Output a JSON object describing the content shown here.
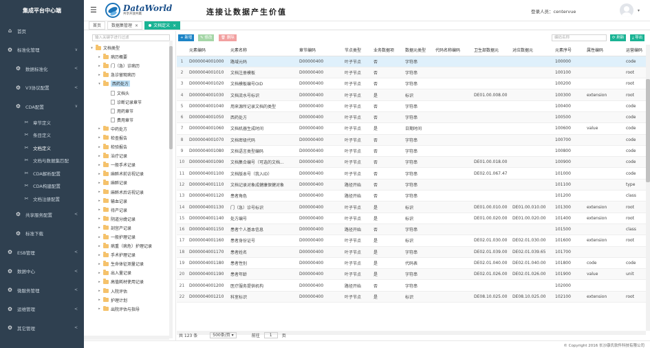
{
  "app": {
    "title": "集成平台中心端"
  },
  "sidebar": {
    "items": [
      {
        "label": "首页",
        "icon": "home-icon",
        "level": 1,
        "arrow": ""
      },
      {
        "label": "标准化管理",
        "icon": "gear-icon",
        "level": 1,
        "arrow": "∨"
      },
      {
        "label": "数据标准化",
        "icon": "gear-icon",
        "level": 2,
        "arrow": "<"
      },
      {
        "label": "V3协议配置",
        "icon": "gear-icon",
        "level": 2,
        "arrow": "<"
      },
      {
        "label": "CDA配置",
        "icon": "gear-icon",
        "level": 2,
        "arrow": "∨"
      },
      {
        "label": "章节定义",
        "icon": "cut-icon",
        "level": 3,
        "arrow": ""
      },
      {
        "label": "条目定义",
        "icon": "cut-icon",
        "level": 3,
        "arrow": ""
      },
      {
        "label": "文档定义",
        "icon": "cut-icon",
        "level": 3,
        "arrow": "",
        "active": true
      },
      {
        "label": "文档与数据集匹配",
        "icon": "cut-icon",
        "level": 3,
        "arrow": ""
      },
      {
        "label": "CDA解析配置",
        "icon": "cut-icon",
        "level": 3,
        "arrow": ""
      },
      {
        "label": "CDA构建配置",
        "icon": "cut-icon",
        "level": 3,
        "arrow": ""
      },
      {
        "label": "文档注册配置",
        "icon": "cut-icon",
        "level": 3,
        "arrow": ""
      },
      {
        "label": "共享服务配置",
        "icon": "gear-icon",
        "level": 2,
        "arrow": "<"
      },
      {
        "label": "标准下载",
        "icon": "gear-icon",
        "level": 2,
        "arrow": ""
      },
      {
        "label": "ESB管理",
        "icon": "gear-icon",
        "level": 1,
        "arrow": "<"
      },
      {
        "label": "数据中心",
        "icon": "gear-icon",
        "level": 1,
        "arrow": "<"
      },
      {
        "label": "微服务管理",
        "icon": "gear-icon",
        "level": 1,
        "arrow": "<"
      },
      {
        "label": "运维管理",
        "icon": "gear-icon",
        "level": 1,
        "arrow": "<"
      },
      {
        "label": "其它管理",
        "icon": "gear-icon",
        "level": 1,
        "arrow": "<"
      }
    ]
  },
  "header": {
    "logo_title": "DataWorld",
    "logo_sub": "共享开放共赢",
    "slogan": "连接让数据产生价值",
    "user_label": "登录人员：centervue"
  },
  "tabs": [
    {
      "label": "首页",
      "active": false
    },
    {
      "label": "数据集管理",
      "active": false,
      "close": "×"
    },
    {
      "label": "文档定义",
      "active": true,
      "close": "×"
    }
  ],
  "tree": {
    "search_placeholder": "输入关键字进行过滤",
    "nodes": [
      {
        "label": "文档类型",
        "depth": 0,
        "toggle": "▾",
        "type": "folder"
      },
      {
        "label": "病历概要",
        "depth": 1,
        "toggle": "▸",
        "type": "folder"
      },
      {
        "label": "门（急）诊病历",
        "depth": 1,
        "toggle": "▸",
        "type": "folder"
      },
      {
        "label": "急诊留观病历",
        "depth": 1,
        "toggle": "▸",
        "type": "folder"
      },
      {
        "label": "西药处方",
        "depth": 1,
        "toggle": "▾",
        "type": "folder",
        "selected": true
      },
      {
        "label": "文档头",
        "depth": 2,
        "toggle": "",
        "type": "file"
      },
      {
        "label": "诊断记录章节",
        "depth": 2,
        "toggle": "",
        "type": "file"
      },
      {
        "label": "用药章节",
        "depth": 2,
        "toggle": "",
        "type": "file"
      },
      {
        "label": "费用章节",
        "depth": 2,
        "toggle": "",
        "type": "file"
      },
      {
        "label": "中药处方",
        "depth": 1,
        "toggle": "▸",
        "type": "folder"
      },
      {
        "label": "检查报告",
        "depth": 1,
        "toggle": "▸",
        "type": "folder"
      },
      {
        "label": "检验报告",
        "depth": 1,
        "toggle": "▸",
        "type": "folder"
      },
      {
        "label": "治疗记录",
        "depth": 1,
        "toggle": "▸",
        "type": "folder"
      },
      {
        "label": "一般手术记录",
        "depth": 1,
        "toggle": "▸",
        "type": "folder"
      },
      {
        "label": "麻醉术前访视记录",
        "depth": 1,
        "toggle": "▸",
        "type": "folder"
      },
      {
        "label": "麻醉记录",
        "depth": 1,
        "toggle": "▸",
        "type": "folder"
      },
      {
        "label": "麻醉术后访视记录",
        "depth": 1,
        "toggle": "▸",
        "type": "folder"
      },
      {
        "label": "输血记录",
        "depth": 1,
        "toggle": "▸",
        "type": "folder"
      },
      {
        "label": "待产记录",
        "depth": 1,
        "toggle": "▸",
        "type": "folder"
      },
      {
        "label": "阴道分娩记录",
        "depth": 1,
        "toggle": "▸",
        "type": "folder"
      },
      {
        "label": "剖宫产记录",
        "depth": 1,
        "toggle": "▸",
        "type": "folder"
      },
      {
        "label": "一般护理记录",
        "depth": 1,
        "toggle": "▸",
        "type": "folder"
      },
      {
        "label": "病重（病危）护理记录",
        "depth": 1,
        "toggle": "▸",
        "type": "folder"
      },
      {
        "label": "手术护理记录",
        "depth": 1,
        "toggle": "▸",
        "type": "folder"
      },
      {
        "label": "生命体征测量记录",
        "depth": 1,
        "toggle": "▸",
        "type": "folder"
      },
      {
        "label": "出入量记录",
        "depth": 1,
        "toggle": "▸",
        "type": "folder"
      },
      {
        "label": "高值耗材使用记录",
        "depth": 1,
        "toggle": "▸",
        "type": "folder"
      },
      {
        "label": "入院评估",
        "depth": 1,
        "toggle": "▸",
        "type": "folder"
      },
      {
        "label": "护理计划",
        "depth": 1,
        "toggle": "▸",
        "type": "folder"
      },
      {
        "label": "出院评估与指导",
        "depth": 1,
        "toggle": "▸",
        "type": "folder"
      }
    ]
  },
  "toolbar": {
    "add_label": "+ 新增",
    "edit_label": "✎ 修改",
    "delete_label": "🗑 删除",
    "search_placeholder": "编码名称",
    "refresh_label": "⟳ 刷新",
    "export_label": "⤓ 导出"
  },
  "table": {
    "columns": [
      "",
      "元素编码",
      "元素名称",
      "章节编码",
      "节点类型",
      "业务数据项",
      "数据元类型",
      "代码名称编码",
      "卫生部数据元",
      "对应数据元",
      "元素序号",
      "属性编码",
      "运营编码"
    ],
    "rows": [
      [
        "1",
        "D000004001000",
        "路域元码",
        "D00000400",
        "叶子节点",
        "否",
        "字符串",
        "",
        "",
        "",
        "100000",
        "",
        "code"
      ],
      [
        "2",
        "D000004001010",
        "文档注册模板",
        "D00000400",
        "叶子节点",
        "否",
        "字符串",
        "",
        "",
        "",
        "100100",
        "",
        "root"
      ],
      [
        "3",
        "D000004001020",
        "文档模板编号OID",
        "D00000400",
        "叶子节点",
        "否",
        "字符串",
        "",
        "",
        "",
        "100200",
        "",
        "root"
      ],
      [
        "4",
        "D000004001030",
        "文档流水号标识",
        "D00000400",
        "叶子节点",
        "是",
        "标识",
        "",
        "DE01.00.008.00",
        "",
        "100300",
        "extension",
        "root"
      ],
      [
        "5",
        "D000004001040",
        "用来源所记录文档的类型",
        "D00000400",
        "叶子节点",
        "否",
        "字符串",
        "",
        "",
        "",
        "100400",
        "",
        "code"
      ],
      [
        "6",
        "D000004001050",
        "西药处方",
        "D00000400",
        "叶子节点",
        "否",
        "字符串",
        "",
        "",
        "",
        "100500",
        "",
        "code"
      ],
      [
        "7",
        "D000004001060",
        "文档机器生成时间",
        "D00000400",
        "叶子节点",
        "是",
        "日期时间",
        "",
        "",
        "",
        "100600",
        "value",
        "code"
      ],
      [
        "8",
        "D000004001070",
        "文档密级代码",
        "D00000400",
        "叶子节点",
        "否",
        "字符串",
        "",
        "",
        "",
        "100700",
        "",
        "code"
      ],
      [
        "9",
        "D000004001080",
        "文档语言类型编码",
        "D00000400",
        "叶子节点",
        "否",
        "字符串",
        "",
        "",
        "",
        "100800",
        "",
        "code"
      ],
      [
        "10",
        "D000004001090",
        "文档集合编号（可选的文档...",
        "D00000400",
        "叶子节点",
        "否",
        "字符串",
        "",
        "DE01.00.018.00",
        "",
        "100900",
        "",
        "code"
      ],
      [
        "11",
        "D000004001100",
        "文档版本号（我入ID）",
        "D00000400",
        "叶子节点",
        "否",
        "字符串",
        "",
        "DE02.01.067.47",
        "",
        "101000",
        "",
        "code"
      ],
      [
        "12",
        "D000004001110",
        "文档记录对象成健康保健对象",
        "D00000400",
        "路径开始",
        "否",
        "字符串",
        "",
        "",
        "",
        "101100",
        "",
        "type"
      ],
      [
        "13",
        "D000004001120",
        "患者角色",
        "D00000400",
        "路径开始",
        "否",
        "字符串",
        "",
        "",
        "",
        "101200",
        "",
        "class"
      ],
      [
        "14",
        "D000004001130",
        "门（急）诊号标识",
        "D00000400",
        "叶子节点",
        "是",
        "标识",
        "",
        "DE01.00.010.00",
        "DE01.00.010.00",
        "101300",
        "extension",
        "root"
      ],
      [
        "15",
        "D000004001140",
        "处方编号",
        "D00000400",
        "叶子节点",
        "是",
        "标识",
        "",
        "DE01.00.020.00",
        "DE01.00.020.00",
        "101400",
        "extension",
        "root"
      ],
      [
        "16",
        "D000004001150",
        "患者个人基本信息",
        "D00000400",
        "路径开始",
        "否",
        "字符串",
        "",
        "",
        "",
        "101500",
        "",
        "class"
      ],
      [
        "17",
        "D000004001160",
        "患者身份证号",
        "D00000400",
        "叶子节点",
        "是",
        "标识",
        "",
        "DE02.01.030.00",
        "DE02.01.030.00",
        "101600",
        "extension",
        "root"
      ],
      [
        "18",
        "D000004001170",
        "患者姓名",
        "D00000400",
        "叶子节点",
        "是",
        "字符串",
        "",
        "DE02.01.039.00",
        "DE02.01.039.65",
        "101700",
        "",
        ""
      ],
      [
        "19",
        "D000004001180",
        "患者性别",
        "D00000400",
        "叶子节点",
        "是",
        "代码表",
        "",
        "DE02.01.040.00",
        "DE02.01.040.00",
        "101800",
        "code",
        "code"
      ],
      [
        "20",
        "D000004001190",
        "患者年龄",
        "D00000400",
        "叶子节点",
        "是",
        "字符串",
        "",
        "DE02.01.026.00",
        "DE02.01.026.00",
        "101900",
        "value",
        "unit"
      ],
      [
        "21",
        "D000004001200",
        "医疗服务提供机构",
        "D00000400",
        "路径开始",
        "否",
        "字符串",
        "",
        "",
        "",
        "102000",
        "",
        ""
      ],
      [
        "22",
        "D000004001210",
        "科室标识",
        "D00000400",
        "叶子节点",
        "是",
        "标识",
        "",
        "DE08.10.025.00",
        "DE08.10.025.00",
        "102100",
        "extension",
        "root"
      ]
    ]
  },
  "pager": {
    "total": "共 123 条",
    "page_size": "500条/页 ▾",
    "prev": "前往",
    "page": "1",
    "page_suffix": "页"
  },
  "footer": {
    "copyright": "© Copyright 2016 长沙康氏软件科技有限公司"
  },
  "colors": {
    "sidebar_bg": "#2f4050",
    "accent": "#1ab394",
    "primary": "#1c84c6",
    "row_highlight": "#dff0fb"
  }
}
